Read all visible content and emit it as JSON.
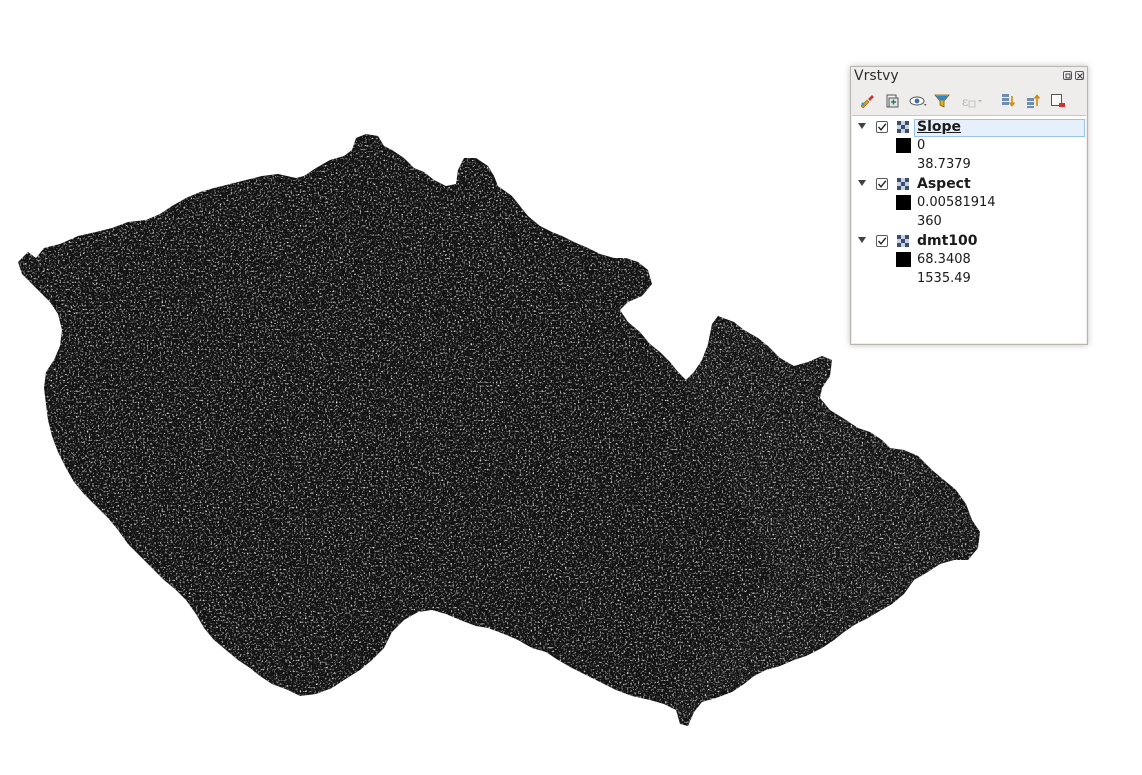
{
  "panel": {
    "title": "Vrstvy"
  },
  "toolbar": [
    {
      "name": "style-icon"
    },
    {
      "name": "add-group-icon"
    },
    {
      "name": "visibility-icon"
    },
    {
      "name": "filter-icon"
    },
    {
      "name": "expression-filter-icon"
    },
    {
      "name": "expand-all-icon"
    },
    {
      "name": "collapse-all-icon"
    },
    {
      "name": "remove-layer-icon"
    }
  ],
  "layers": [
    {
      "name": "Slope",
      "checked": true,
      "selected": true,
      "min": "0",
      "max": "38.7379"
    },
    {
      "name": "Aspect",
      "checked": true,
      "selected": false,
      "min": "0.00581914",
      "max": "360"
    },
    {
      "name": "dmt100",
      "checked": true,
      "selected": false,
      "min": "68.3408",
      "max": "1535.49"
    }
  ],
  "colors": {
    "map_fill": "#121212",
    "selection": "#e6f0fa",
    "panel_bg": "#efedeb"
  }
}
